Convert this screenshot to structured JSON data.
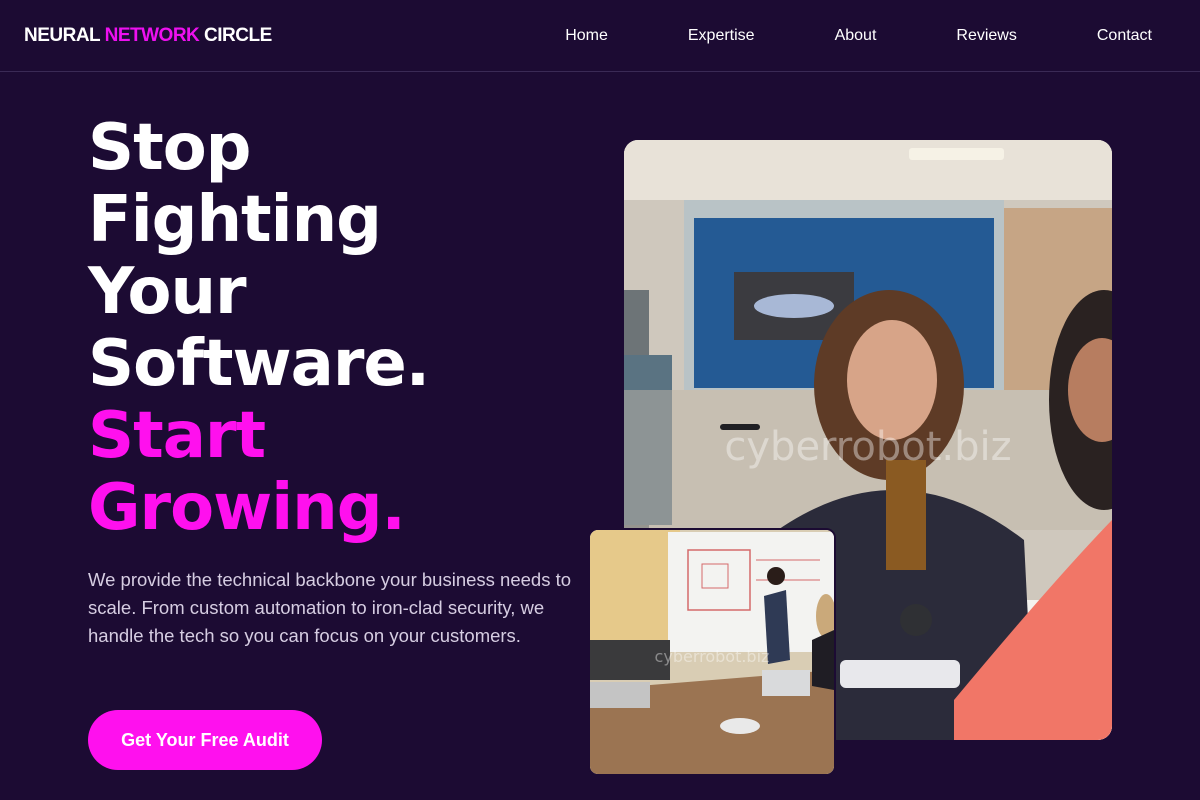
{
  "logo": {
    "part1": "NEURAL ",
    "part2": "NETWORK",
    "part3": " CIRCLE"
  },
  "nav": {
    "items": [
      "Home",
      "Expertise",
      "About",
      "Reviews",
      "Contact"
    ]
  },
  "hero": {
    "title_lines": [
      "Stop",
      "Fighting",
      "Your",
      "Software."
    ],
    "accent_lines": [
      "Start",
      "Growing."
    ],
    "description": "We provide the technical backbone your business needs to scale. From custom automation to iron-clad security, we handle the tech so you can focus on your customers.",
    "cta_label": "Get Your Free Audit"
  },
  "images": {
    "main_watermark": "cyberrobot.biz",
    "small_watermark": "cyberrobot.biz"
  },
  "colors": {
    "background": "#1c0b33",
    "accent": "#ff10ee",
    "text": "#ffffff"
  }
}
